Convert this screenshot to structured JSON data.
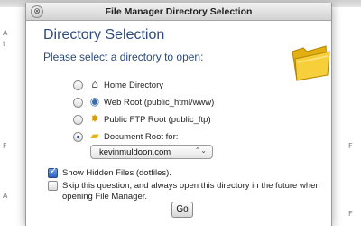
{
  "dialog": {
    "title": "File Manager Directory Selection",
    "close_glyph": "⊗",
    "heading": "Directory Selection",
    "subheading": "Please select a directory to open:",
    "folder_icon": "folder-icon",
    "options": [
      {
        "label": "Home Directory",
        "icon": "home-icon",
        "glyph": "⌂",
        "selected": false
      },
      {
        "label": "Web Root (public_html/www)",
        "icon": "globe-icon",
        "glyph": "◉",
        "selected": false
      },
      {
        "label": "Public FTP Root (public_ftp)",
        "icon": "ftp-icon",
        "glyph": "✸",
        "selected": false
      },
      {
        "label": "Document Root for:",
        "icon": "folder-icon",
        "glyph": "▰",
        "selected": true
      }
    ],
    "domain_select": {
      "value": "kevinmuldoon.com",
      "arrow": "⌃⌄"
    },
    "show_hidden": {
      "label": "Show Hidden Files (dotfiles).",
      "checked": true,
      "tick": "✓"
    },
    "skip_question": {
      "label": "Skip this question, and always open this directory in the future when opening File Manager.",
      "checked": false
    },
    "go_label": "Go"
  },
  "background": {
    "marks": [
      "A",
      "t",
      "F",
      "F",
      "A",
      "F"
    ]
  },
  "colors": {
    "heading": "#2c4a7c",
    "folder": "#f0c419",
    "checkbox_on": "#2b61c2"
  }
}
